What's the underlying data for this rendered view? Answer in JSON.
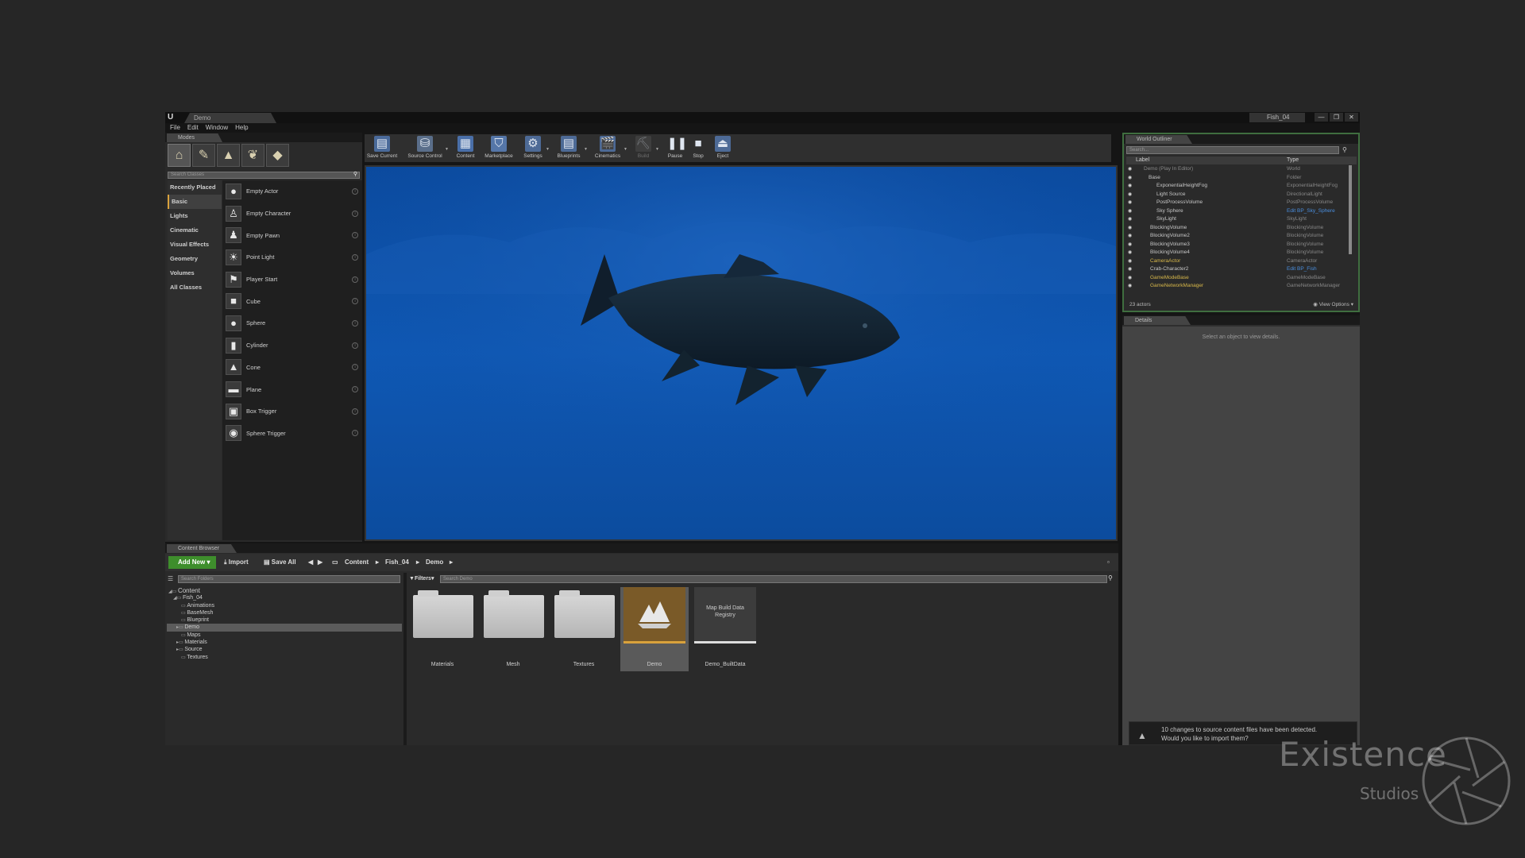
{
  "titlebar": {
    "doc_tab": "Demo",
    "project_name": "Fish_04",
    "window_buttons": [
      "—",
      "❐",
      "✕"
    ]
  },
  "menu": [
    "File",
    "Edit",
    "Window",
    "Help"
  ],
  "modes": {
    "tab": "Modes",
    "search_placeholder": "Search Classes",
    "categories": [
      "Recently Placed",
      "Basic",
      "Lights",
      "Cinematic",
      "Visual Effects",
      "Geometry",
      "Volumes",
      "All Classes"
    ],
    "active_category": "Basic",
    "items": [
      {
        "label": "Empty Actor",
        "icon": "sphere-icon"
      },
      {
        "label": "Empty Character",
        "icon": "character-icon"
      },
      {
        "label": "Empty Pawn",
        "icon": "pawn-icon"
      },
      {
        "label": "Point Light",
        "icon": "light-bulb-icon"
      },
      {
        "label": "Player Start",
        "icon": "player-start-icon"
      },
      {
        "label": "Cube",
        "icon": "cube-icon"
      },
      {
        "label": "Sphere",
        "icon": "sphere-icon"
      },
      {
        "label": "Cylinder",
        "icon": "cylinder-icon"
      },
      {
        "label": "Cone",
        "icon": "cone-icon"
      },
      {
        "label": "Plane",
        "icon": "plane-icon"
      },
      {
        "label": "Box Trigger",
        "icon": "box-trigger-icon"
      },
      {
        "label": "Sphere Trigger",
        "icon": "sphere-trigger-icon"
      }
    ]
  },
  "toolbar": {
    "buttons": [
      {
        "label": "Save Current",
        "icon": "save-icon"
      },
      {
        "label": "Source Control",
        "icon": "source-control-icon"
      },
      {
        "label": "Content",
        "icon": "content-icon"
      },
      {
        "label": "Marketplace",
        "icon": "marketplace-icon"
      },
      {
        "label": "Settings",
        "icon": "settings-icon"
      },
      {
        "label": "Blueprints",
        "icon": "blueprints-icon"
      },
      {
        "label": "Cinematics",
        "icon": "cinematics-icon"
      },
      {
        "label": "Build",
        "icon": "build-icon"
      },
      {
        "label": "Pause",
        "icon": "pause-icon"
      },
      {
        "label": "Stop",
        "icon": "stop-icon"
      },
      {
        "label": "Eject",
        "icon": "eject-icon"
      }
    ]
  },
  "outliner": {
    "tab": "World Outliner",
    "search_placeholder": "Search...",
    "col_label": "Label",
    "col_type": "Type",
    "rows": [
      {
        "name": "Demo (Play In Editor)",
        "type": "World"
      },
      {
        "name": "Base",
        "type": "Folder"
      },
      {
        "name": "ExponentialHeightFog",
        "type": "ExponentialHeightFog"
      },
      {
        "name": "Light Source",
        "type": "DirectionalLight"
      },
      {
        "name": "PostProcessVolume",
        "type": "PostProcessVolume"
      },
      {
        "name": "Sky Sphere",
        "type": "Edit BP_Sky_Sphere"
      },
      {
        "name": "SkyLight",
        "type": "SkyLight"
      },
      {
        "name": "BlockingVolume",
        "type": "BlockingVolume"
      },
      {
        "name": "BlockingVolume2",
        "type": "BlockingVolume"
      },
      {
        "name": "BlockingVolume3",
        "type": "BlockingVolume"
      },
      {
        "name": "BlockingVolume4",
        "type": "BlockingVolume"
      },
      {
        "name": "CameraActor",
        "type": "CameraActor"
      },
      {
        "name": "Crab-Character2",
        "type": "Edit BP_Fish"
      },
      {
        "name": "GameModeBase",
        "type": "GameModeBase"
      },
      {
        "name": "GameNetworkManager",
        "type": "GameNetworkManager"
      }
    ],
    "count": "23 actors",
    "view_options": "View Options"
  },
  "details": {
    "tab": "Details",
    "message": "Select an object to view details."
  },
  "notification": {
    "line1": "10 changes to source content files have been detected.",
    "line2": "Would you like to import them?"
  },
  "content_browser": {
    "tab": "Content Browser",
    "add_new": "Add New",
    "import": "Import",
    "save_all": "Save All",
    "breadcrumbs": [
      "Content",
      "Fish_04",
      "Demo"
    ],
    "folder_search_placeholder": "Search Folders",
    "filters": "Filters",
    "asset_search_placeholder": "Search Demo",
    "tree": [
      {
        "label": "Content",
        "depth": 0
      },
      {
        "label": "Fish_04",
        "depth": 1
      },
      {
        "label": "Animations",
        "depth": 2
      },
      {
        "label": "BaseMesh",
        "depth": 2
      },
      {
        "label": "Blueprint",
        "depth": 2
      },
      {
        "label": "Demo",
        "depth": 2
      },
      {
        "label": "Maps",
        "depth": 2
      },
      {
        "label": "Materials",
        "depth": 2
      },
      {
        "label": "Source",
        "depth": 2
      },
      {
        "label": "Textures",
        "depth": 2
      }
    ],
    "selected_tree": "Demo",
    "assets": [
      {
        "name": "Materials",
        "kind": "folder"
      },
      {
        "name": "Mesh",
        "kind": "folder"
      },
      {
        "name": "Textures",
        "kind": "folder"
      },
      {
        "name": "Demo",
        "kind": "level"
      },
      {
        "name": "Demo_BuiltData",
        "kind": "data",
        "inner_label": "Map Build Data Registry"
      }
    ]
  },
  "watermark": {
    "title": "Existence",
    "subtitle": "Studios"
  },
  "colors": {
    "viewport_water": "#0e4fa8",
    "add_new_green": "#3e8e2c",
    "selection_gold": "#d9a23c",
    "outliner_border": "#3f6e3f"
  }
}
